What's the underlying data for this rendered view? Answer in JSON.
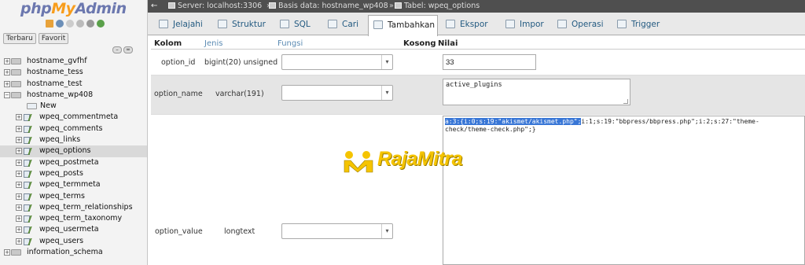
{
  "nav": {
    "logo": {
      "php": "php",
      "my": "My",
      "admin": "Admin"
    },
    "tabs": [
      "Terbaru",
      "Favorit"
    ],
    "tree": [
      {
        "label": "hostname_gvfhf",
        "level": 0,
        "kind": "db"
      },
      {
        "label": "hostname_tess",
        "level": 0,
        "kind": "db"
      },
      {
        "label": "hostname_test",
        "level": 0,
        "kind": "db"
      },
      {
        "label": "hostname_wp408",
        "level": 0,
        "kind": "db"
      },
      {
        "label": "New",
        "level": 1,
        "kind": "new"
      },
      {
        "label": "wpeq_commentmeta",
        "level": 1,
        "kind": "table"
      },
      {
        "label": "wpeq_comments",
        "level": 1,
        "kind": "table"
      },
      {
        "label": "wpeq_links",
        "level": 1,
        "kind": "table"
      },
      {
        "label": "wpeq_options",
        "level": 1,
        "kind": "table",
        "active": true
      },
      {
        "label": "wpeq_postmeta",
        "level": 1,
        "kind": "table"
      },
      {
        "label": "wpeq_posts",
        "level": 1,
        "kind": "table"
      },
      {
        "label": "wpeq_termmeta",
        "level": 1,
        "kind": "table"
      },
      {
        "label": "wpeq_terms",
        "level": 1,
        "kind": "table"
      },
      {
        "label": "wpeq_term_relationships",
        "level": 1,
        "kind": "table"
      },
      {
        "label": "wpeq_term_taxonomy",
        "level": 1,
        "kind": "table"
      },
      {
        "label": "wpeq_usermeta",
        "level": 1,
        "kind": "table"
      },
      {
        "label": "wpeq_users",
        "level": 1,
        "kind": "table"
      },
      {
        "label": "information_schema",
        "level": 0,
        "kind": "db"
      }
    ]
  },
  "breadcrumb": {
    "server": "Server: localhost:3306",
    "database": "Basis data: hostname_wp408",
    "table": "Tabel: wpeq_options",
    "separator": "»"
  },
  "tabs": [
    {
      "label": "Jelajahi",
      "icon": "browse-icon"
    },
    {
      "label": "Struktur",
      "icon": "structure-icon"
    },
    {
      "label": "SQL",
      "icon": "sql-icon"
    },
    {
      "label": "Cari",
      "icon": "search-icon"
    },
    {
      "label": "Tambahkan",
      "icon": "insert-icon",
      "active": true
    },
    {
      "label": "Ekspor",
      "icon": "export-icon"
    },
    {
      "label": "Impor",
      "icon": "import-icon"
    },
    {
      "label": "Operasi",
      "icon": "wrench-icon"
    },
    {
      "label": "Trigger",
      "icon": "trigger-icon"
    }
  ],
  "form": {
    "headers": {
      "column": "Kolom",
      "type": "Jenis",
      "function": "Fungsi",
      "null": "Kosong",
      "value": "Nilai"
    },
    "rows": [
      {
        "column": "option_id",
        "type": "bigint(20) unsigned",
        "function": "",
        "value": "33"
      },
      {
        "column": "option_name",
        "type": "varchar(191)",
        "function": "",
        "value": "active_plugins"
      },
      {
        "column": "option_value",
        "type": "longtext",
        "function": "",
        "value_selected": "a:3:{i:0;s:19:\"akismet/akismet.php\";",
        "value_rest": "i:1;s:19:\"bbpress/bbpress.php\";i:2;s:27:\"theme-check/theme-check.php\";}"
      }
    ]
  },
  "watermark": {
    "text": "RajaMitra"
  },
  "colors": {
    "accent": "#235a81",
    "selection": "#3876d6",
    "breadcrumb_bg": "#4f4f4f",
    "watermark": "#f5c400"
  }
}
